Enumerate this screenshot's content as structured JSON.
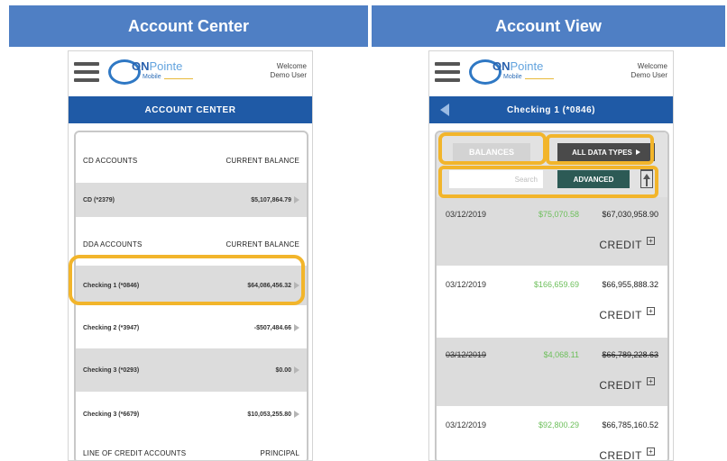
{
  "banners": {
    "left": "Account Center",
    "right": "Account View"
  },
  "header": {
    "logo_on": "ON",
    "logo_pointe": "Pointe",
    "logo_sub": "Mobile",
    "welcome_line1": "Welcome",
    "welcome_line2": "Demo User"
  },
  "account_center": {
    "nav_title": "ACCOUNT CENTER",
    "sections": [
      {
        "label": "CD ACCOUNTS",
        "value_label": "CURRENT BALANCE"
      },
      {
        "label": "DDA ACCOUNTS",
        "value_label": "CURRENT BALANCE"
      },
      {
        "label": "LINE OF CREDIT ACCOUNTS",
        "value_label": "PRINCIPAL"
      }
    ],
    "accounts": [
      {
        "name": "CD (*2379)",
        "balance": "$5,107,864.79"
      },
      {
        "name": "Checking 1 (*0846)",
        "balance": "$64,086,456.32"
      },
      {
        "name": "Checking 2 (*3947)",
        "balance": "-$507,484.66"
      },
      {
        "name": "Checking 3 (*0293)",
        "balance": "$0.00"
      },
      {
        "name": "Checking 3 (*6679)",
        "balance": "$10,053,255.80"
      }
    ]
  },
  "account_view": {
    "nav_title": "Checking 1 (*0846)",
    "balances_label": "BALANCES",
    "data_types_label": "ALL DATA TYPES",
    "search_placeholder": "Search",
    "advanced_label": "ADVANCED",
    "transactions": [
      {
        "date": "03/12/2019",
        "amount": "$75,070.58",
        "balance": "$67,030,958.90",
        "type": "CREDIT"
      },
      {
        "date": "03/12/2019",
        "amount": "$166,659.69",
        "balance": "$66,955,888.32",
        "type": "CREDIT"
      },
      {
        "date": "03/12/2019",
        "amount": "$4,068.11",
        "balance": "$66,789,228.63",
        "type": "CREDIT"
      },
      {
        "date": "03/12/2019",
        "amount": "$92,800.29",
        "balance": "$66,785,160.52",
        "type": "CREDIT"
      }
    ],
    "expand_symbol": "+"
  },
  "colors": {
    "banner": "#4f7fc4",
    "nav_bar": "#1f5aa6",
    "highlight": "#f2b52b",
    "amount_green": "#6cbf5a",
    "advanced_btn": "#2c5a55"
  }
}
